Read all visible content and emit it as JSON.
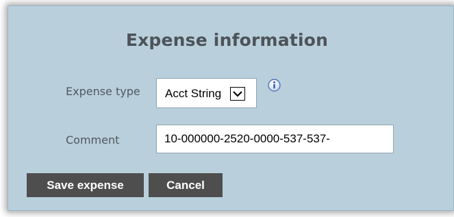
{
  "dialog": {
    "title": "Expense information",
    "background_color": "#b9cfdc"
  },
  "fields": {
    "expense_type": {
      "label": "Expense type",
      "selected_value": "Acct String"
    },
    "comment": {
      "label": "Comment",
      "value": "10-000000-2520-0000-537-537-"
    }
  },
  "icons": {
    "info": "info-icon",
    "dropdown": "chevron-down-icon"
  },
  "buttons": {
    "save_label": "Save expense",
    "cancel_label": "Cancel",
    "button_color": "#4e4e4e"
  }
}
